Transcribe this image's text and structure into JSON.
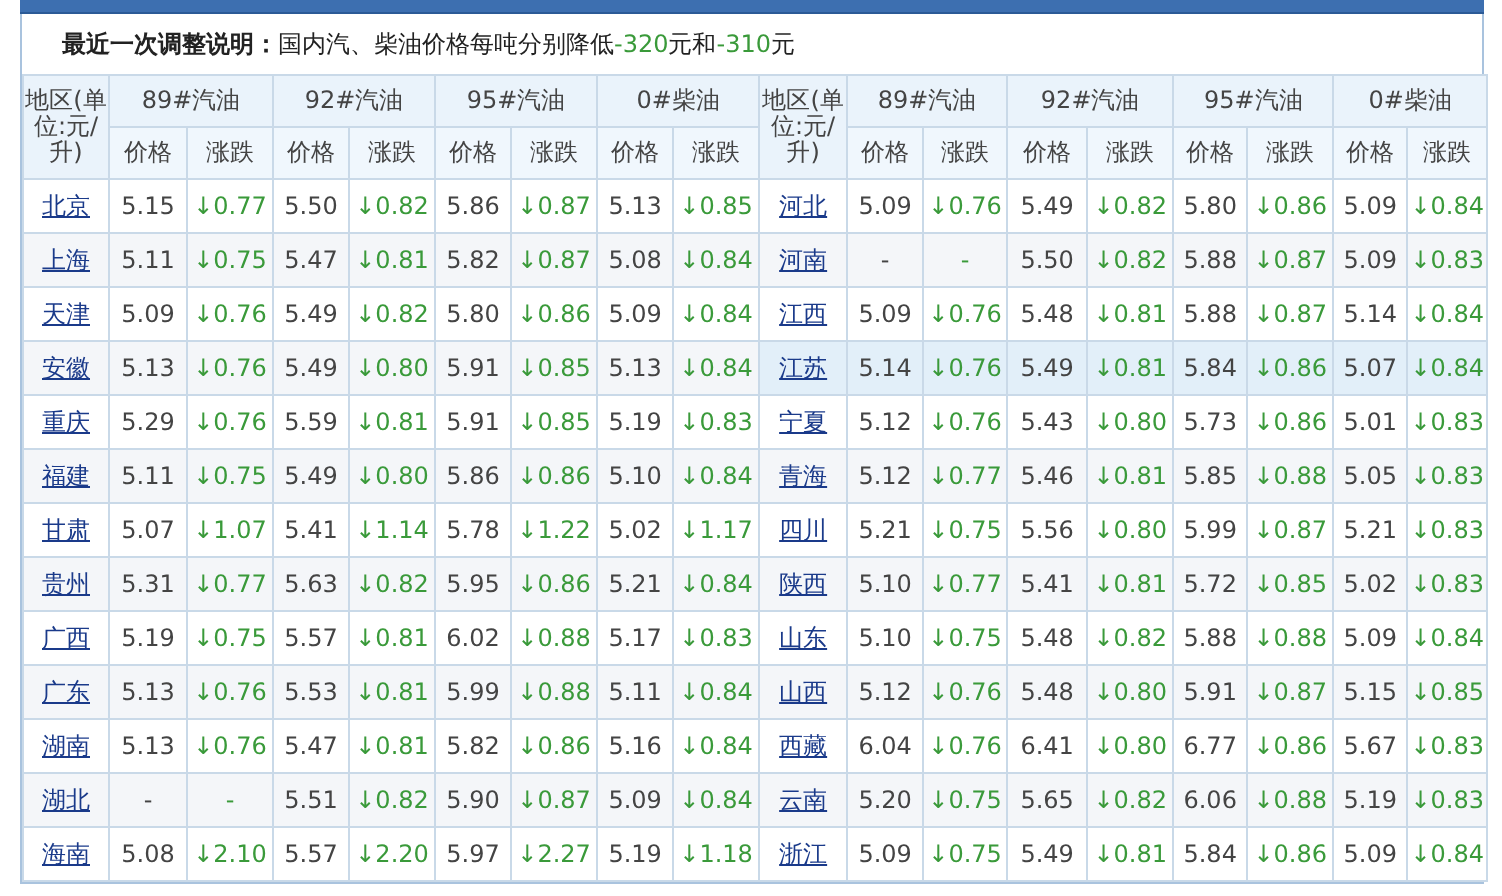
{
  "notice": {
    "label": "最近一次调整说明：",
    "parts": [
      {
        "kind": "plain",
        "text": "国内汽、柴油价格每吨分别降低"
      },
      {
        "kind": "change",
        "text": "-320"
      },
      {
        "kind": "plain",
        "text": "元和"
      },
      {
        "kind": "change",
        "text": "-310"
      },
      {
        "kind": "plain",
        "text": "元"
      }
    ]
  },
  "table": {
    "header_groups": [
      {
        "region_header": "地区(单位:元/升)",
        "fuels": [
          {
            "name": "89#汽油",
            "sub_headers": [
              "价格",
              "涨跌"
            ]
          },
          {
            "name": "92#汽油",
            "sub_headers": [
              "价格",
              "涨跌"
            ]
          },
          {
            "name": "95#汽油",
            "sub_headers": [
              "价格",
              "涨跌"
            ]
          },
          {
            "name": "0#柴油",
            "sub_headers": [
              "价格",
              "涨跌"
            ]
          }
        ]
      },
      {
        "region_header": "地区(单位:元/升)",
        "fuels": [
          {
            "name": "89#汽油",
            "sub_headers": [
              "价格",
              "涨跌"
            ]
          },
          {
            "name": "92#汽油",
            "sub_headers": [
              "价格",
              "涨跌"
            ]
          },
          {
            "name": "95#汽油",
            "sub_headers": [
              "价格",
              "涨跌"
            ]
          },
          {
            "name": "0#柴油",
            "sub_headers": [
              "价格",
              "涨跌"
            ]
          }
        ]
      }
    ],
    "rows": [
      {
        "left": {
          "region": "北京",
          "values": [
            "5.15",
            "↓0.77",
            "5.50",
            "↓0.82",
            "5.86",
            "↓0.87",
            "5.13",
            "↓0.85"
          ],
          "highlighted": false
        },
        "right": {
          "region": "河北",
          "values": [
            "5.09",
            "↓0.76",
            "5.49",
            "↓0.82",
            "5.80",
            "↓0.86",
            "5.09",
            "↓0.84"
          ],
          "highlighted": false
        }
      },
      {
        "left": {
          "region": "上海",
          "values": [
            "5.11",
            "↓0.75",
            "5.47",
            "↓0.81",
            "5.82",
            "↓0.87",
            "5.08",
            "↓0.84"
          ],
          "highlighted": false
        },
        "right": {
          "region": "河南",
          "values": [
            "-",
            "-",
            "5.50",
            "↓0.82",
            "5.88",
            "↓0.87",
            "5.09",
            "↓0.83"
          ],
          "highlighted": false
        }
      },
      {
        "left": {
          "region": "天津",
          "values": [
            "5.09",
            "↓0.76",
            "5.49",
            "↓0.82",
            "5.80",
            "↓0.86",
            "5.09",
            "↓0.84"
          ],
          "highlighted": false
        },
        "right": {
          "region": "江西",
          "values": [
            "5.09",
            "↓0.76",
            "5.48",
            "↓0.81",
            "5.88",
            "↓0.87",
            "5.14",
            "↓0.84"
          ],
          "highlighted": false
        }
      },
      {
        "left": {
          "region": "安徽",
          "values": [
            "5.13",
            "↓0.76",
            "5.49",
            "↓0.80",
            "5.91",
            "↓0.85",
            "5.13",
            "↓0.84"
          ],
          "highlighted": false
        },
        "right": {
          "region": "江苏",
          "values": [
            "5.14",
            "↓0.76",
            "5.49",
            "↓0.81",
            "5.84",
            "↓0.86",
            "5.07",
            "↓0.84"
          ],
          "highlighted": true
        }
      },
      {
        "left": {
          "region": "重庆",
          "values": [
            "5.29",
            "↓0.76",
            "5.59",
            "↓0.81",
            "5.91",
            "↓0.85",
            "5.19",
            "↓0.83"
          ],
          "highlighted": false
        },
        "right": {
          "region": "宁夏",
          "values": [
            "5.12",
            "↓0.76",
            "5.43",
            "↓0.80",
            "5.73",
            "↓0.86",
            "5.01",
            "↓0.83"
          ],
          "highlighted": false
        }
      },
      {
        "left": {
          "region": "福建",
          "values": [
            "5.11",
            "↓0.75",
            "5.49",
            "↓0.80",
            "5.86",
            "↓0.86",
            "5.10",
            "↓0.84"
          ],
          "highlighted": false
        },
        "right": {
          "region": "青海",
          "values": [
            "5.12",
            "↓0.77",
            "5.46",
            "↓0.81",
            "5.85",
            "↓0.88",
            "5.05",
            "↓0.83"
          ],
          "highlighted": false
        }
      },
      {
        "left": {
          "region": "甘肃",
          "values": [
            "5.07",
            "↓1.07",
            "5.41",
            "↓1.14",
            "5.78",
            "↓1.22",
            "5.02",
            "↓1.17"
          ],
          "highlighted": false
        },
        "right": {
          "region": "四川",
          "values": [
            "5.21",
            "↓0.75",
            "5.56",
            "↓0.80",
            "5.99",
            "↓0.87",
            "5.21",
            "↓0.83"
          ],
          "highlighted": false
        }
      },
      {
        "left": {
          "region": "贵州",
          "values": [
            "5.31",
            "↓0.77",
            "5.63",
            "↓0.82",
            "5.95",
            "↓0.86",
            "5.21",
            "↓0.84"
          ],
          "highlighted": false
        },
        "right": {
          "region": "陕西",
          "values": [
            "5.10",
            "↓0.77",
            "5.41",
            "↓0.81",
            "5.72",
            "↓0.85",
            "5.02",
            "↓0.83"
          ],
          "highlighted": false
        }
      },
      {
        "left": {
          "region": "广西",
          "values": [
            "5.19",
            "↓0.75",
            "5.57",
            "↓0.81",
            "6.02",
            "↓0.88",
            "5.17",
            "↓0.83"
          ],
          "highlighted": false
        },
        "right": {
          "region": "山东",
          "values": [
            "5.10",
            "↓0.75",
            "5.48",
            "↓0.82",
            "5.88",
            "↓0.88",
            "5.09",
            "↓0.84"
          ],
          "highlighted": false
        }
      },
      {
        "left": {
          "region": "广东",
          "values": [
            "5.13",
            "↓0.76",
            "5.53",
            "↓0.81",
            "5.99",
            "↓0.88",
            "5.11",
            "↓0.84"
          ],
          "highlighted": false
        },
        "right": {
          "region": "山西",
          "values": [
            "5.12",
            "↓0.76",
            "5.48",
            "↓0.80",
            "5.91",
            "↓0.87",
            "5.15",
            "↓0.85"
          ],
          "highlighted": false
        }
      },
      {
        "left": {
          "region": "湖南",
          "values": [
            "5.13",
            "↓0.76",
            "5.47",
            "↓0.81",
            "5.82",
            "↓0.86",
            "5.16",
            "↓0.84"
          ],
          "highlighted": false
        },
        "right": {
          "region": "西藏",
          "values": [
            "6.04",
            "↓0.76",
            "6.41",
            "↓0.80",
            "6.77",
            "↓0.86",
            "5.67",
            "↓0.83"
          ],
          "highlighted": false
        }
      },
      {
        "left": {
          "region": "湖北",
          "values": [
            "-",
            "-",
            "5.51",
            "↓0.82",
            "5.90",
            "↓0.87",
            "5.09",
            "↓0.84"
          ],
          "highlighted": false
        },
        "right": {
          "region": "云南",
          "values": [
            "5.20",
            "↓0.75",
            "5.65",
            "↓0.82",
            "6.06",
            "↓0.88",
            "5.19",
            "↓0.83"
          ],
          "highlighted": false
        }
      },
      {
        "left": {
          "region": "海南",
          "values": [
            "5.08",
            "↓2.10",
            "5.57",
            "↓2.20",
            "5.97",
            "↓2.27",
            "5.19",
            "↓1.18"
          ],
          "highlighted": false
        },
        "right": {
          "region": "浙江",
          "values": [
            "5.09",
            "↓0.75",
            "5.49",
            "↓0.81",
            "5.84",
            "↓0.86",
            "5.09",
            "↓0.84"
          ],
          "highlighted": false
        }
      }
    ]
  }
}
